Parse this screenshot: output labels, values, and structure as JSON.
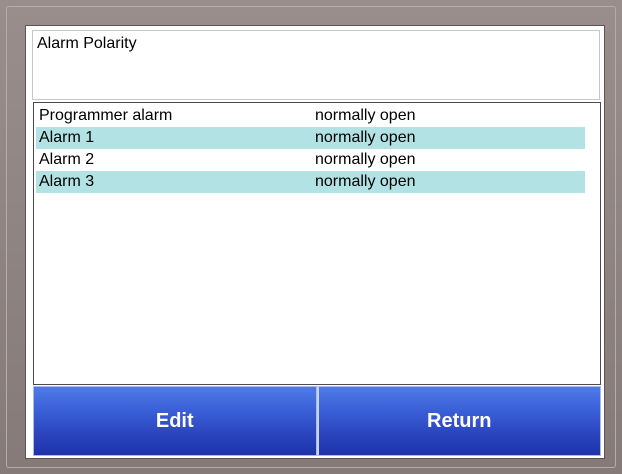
{
  "screen": {
    "title": "Alarm Polarity"
  },
  "alarm_list": {
    "rows": [
      {
        "name": "Programmer alarm",
        "value": "normally open"
      },
      {
        "name": "Alarm 1",
        "value": "normally open"
      },
      {
        "name": "Alarm 2",
        "value": "normally open"
      },
      {
        "name": "Alarm 3",
        "value": "normally open"
      }
    ]
  },
  "buttons": {
    "edit_label": "Edit",
    "return_label": "Return"
  },
  "colors": {
    "frame": "#8f8482",
    "row_highlight": "#b3e2e4",
    "button_blue": "#2f4fcb",
    "button_text": "#ffffff"
  }
}
